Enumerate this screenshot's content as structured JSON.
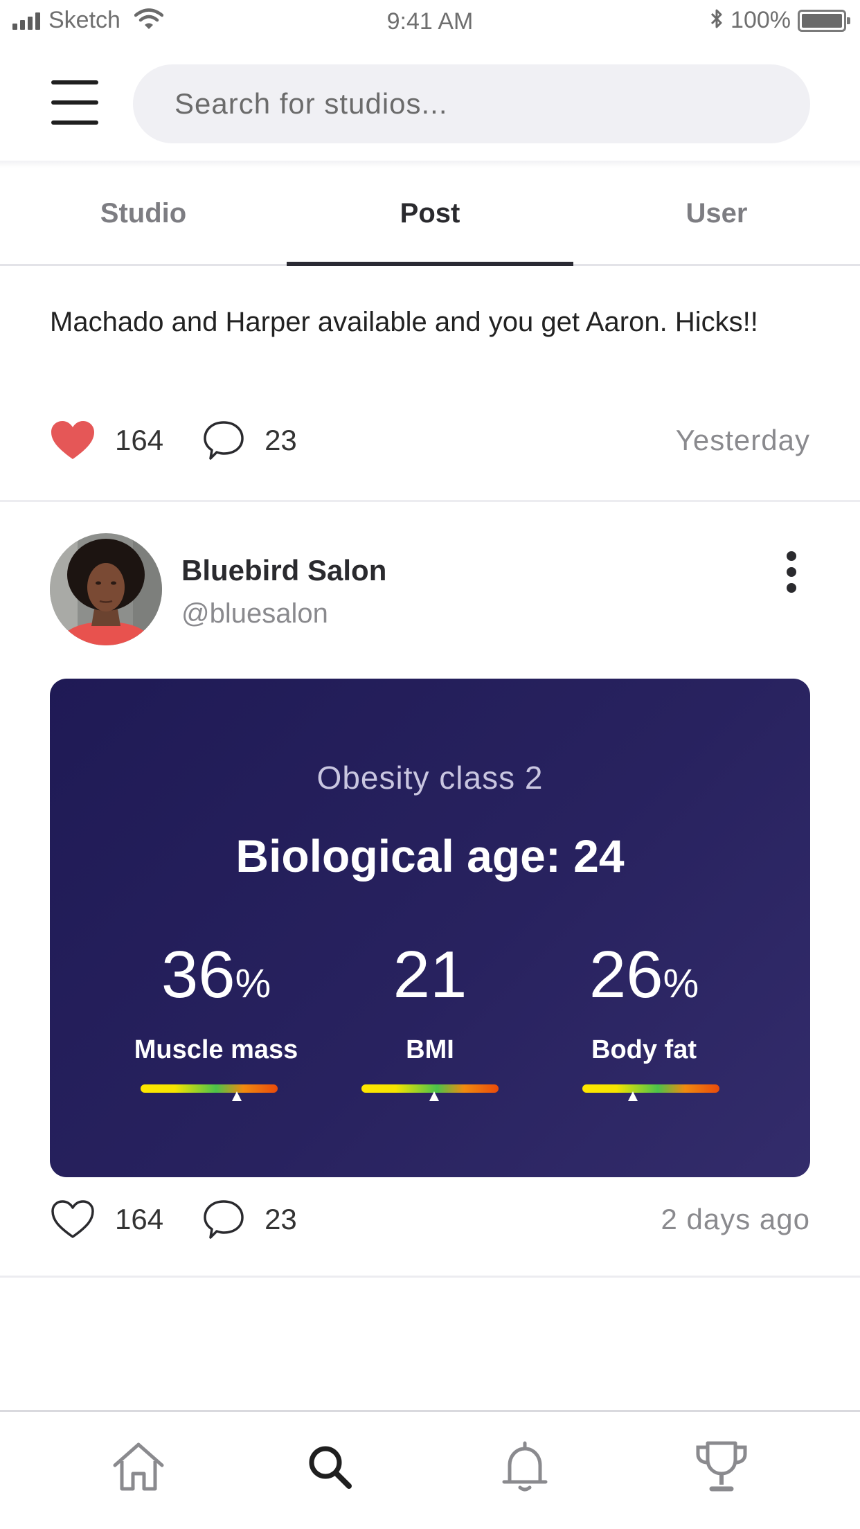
{
  "status_bar": {
    "carrier": "Sketch",
    "time": "9:41 AM",
    "battery": "100%"
  },
  "header": {
    "search_placeholder": "Search for studios..."
  },
  "tabs": [
    {
      "label": "Studio",
      "active": false
    },
    {
      "label": "Post",
      "active": true
    },
    {
      "label": "User",
      "active": false
    }
  ],
  "posts": [
    {
      "text": "Machado and Harper available and you get Aaron. Hicks!!",
      "likes": "164",
      "comments": "23",
      "time": "Yesterday",
      "liked": true
    },
    {
      "author": "Bluebird Salon",
      "handle": "@bluesalon",
      "likes": "164",
      "comments": "23",
      "time": "2 days ago",
      "liked": false,
      "card": {
        "classification": "Obesity class 2",
        "headline": "Biological age: 24",
        "stats": [
          {
            "value": "36",
            "unit": "%",
            "label": "Muscle mass",
            "marker": 0.7
          },
          {
            "value": "21",
            "unit": "",
            "label": "BMI",
            "marker": 0.53
          },
          {
            "value": "26",
            "unit": "%",
            "label": "Body fat",
            "marker": 0.37
          }
        ]
      }
    }
  ],
  "tabbar": [
    {
      "icon": "home-icon",
      "active": false
    },
    {
      "icon": "search-icon",
      "active": true
    },
    {
      "icon": "bell-icon",
      "active": false
    },
    {
      "icon": "trophy-icon",
      "active": false
    }
  ],
  "colors": {
    "heart_active": "#e55757",
    "card_bg": "#231d59",
    "tab_indicator": "#2a2a33"
  }
}
